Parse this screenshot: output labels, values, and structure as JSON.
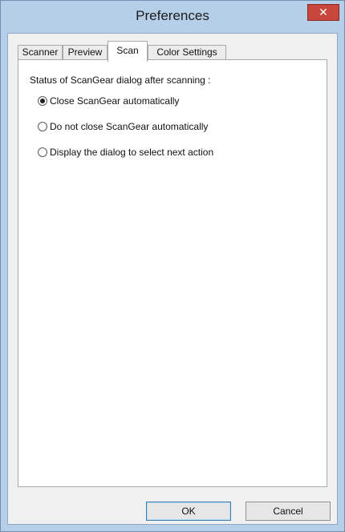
{
  "window": {
    "title": "Preferences",
    "close_glyph": "✕"
  },
  "tabs": [
    {
      "label": "Scanner",
      "active": false
    },
    {
      "label": "Preview",
      "active": false
    },
    {
      "label": "Scan",
      "active": true
    },
    {
      "label": "Color Settings",
      "active": false
    }
  ],
  "scan": {
    "group_label": "Status of ScanGear dialog after scanning :",
    "options": [
      {
        "label": "Close ScanGear automatically",
        "selected": true
      },
      {
        "label": "Do not close ScanGear automatically",
        "selected": false
      },
      {
        "label": "Display the dialog to select next action",
        "selected": false
      }
    ]
  },
  "buttons": {
    "ok": "OK",
    "cancel": "Cancel"
  },
  "colors": {
    "title_bar": "#b6cfe8",
    "close_button": "#c9463d",
    "default_button_border": "#3c7fb1"
  }
}
